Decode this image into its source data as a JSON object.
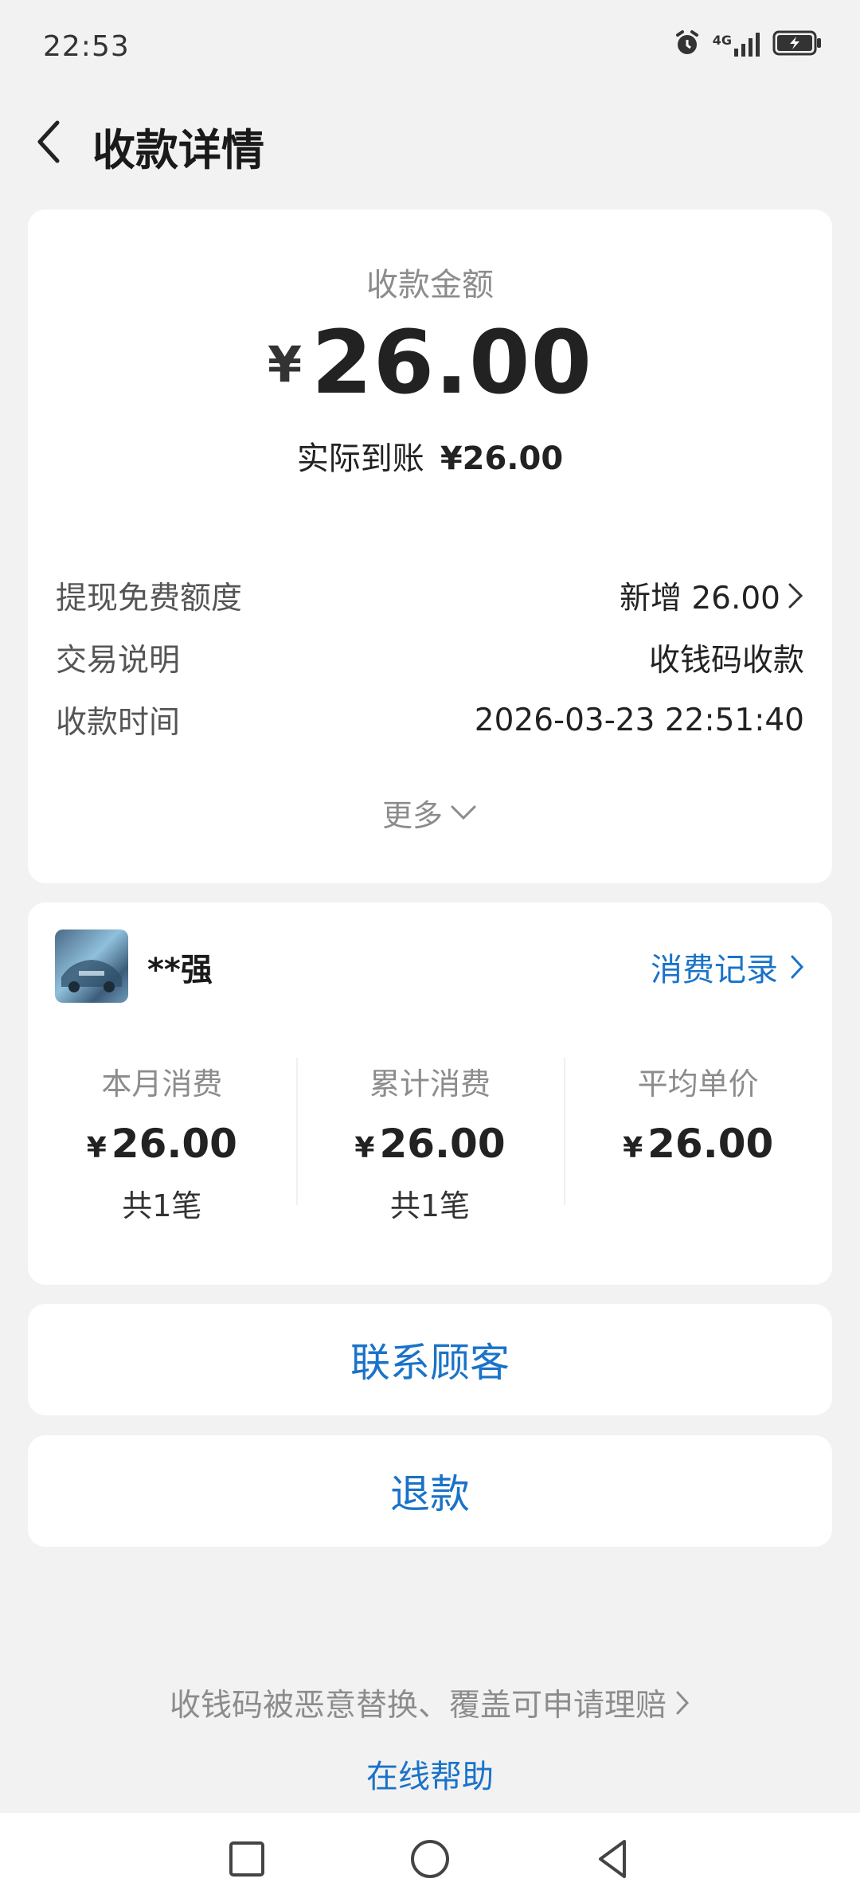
{
  "status": {
    "time": "22:53",
    "network": "4G"
  },
  "header": {
    "title": "收款详情"
  },
  "summary": {
    "amount_label": "收款金额",
    "currency": "¥",
    "amount": "26.00",
    "actual_label": "实际到账",
    "actual_value": "¥26.00"
  },
  "details": [
    {
      "key": "提现免费额度",
      "value": "新增 26.00"
    },
    {
      "key": "交易说明",
      "value": "收钱码收款"
    },
    {
      "key": "收款时间",
      "value": "2026-03-23 22:51:40"
    }
  ],
  "more_label": "更多",
  "customer": {
    "name": "**强",
    "records_label": "消费记录",
    "stats": [
      {
        "label": "本月消费",
        "currency": "¥",
        "amount": "26.00",
        "count": "共1笔"
      },
      {
        "label": "累计消费",
        "currency": "¥",
        "amount": "26.00",
        "count": "共1笔"
      },
      {
        "label": "平均单价",
        "currency": "¥",
        "amount": "26.00",
        "count": ""
      }
    ]
  },
  "actions": {
    "contact": "联系顾客",
    "refund": "退款"
  },
  "footer": {
    "claim": "收钱码被恶意替换、覆盖可申请理赔",
    "help": "在线帮助"
  },
  "colors": {
    "accent": "#1a73c8",
    "background": "#f2f2f2"
  }
}
